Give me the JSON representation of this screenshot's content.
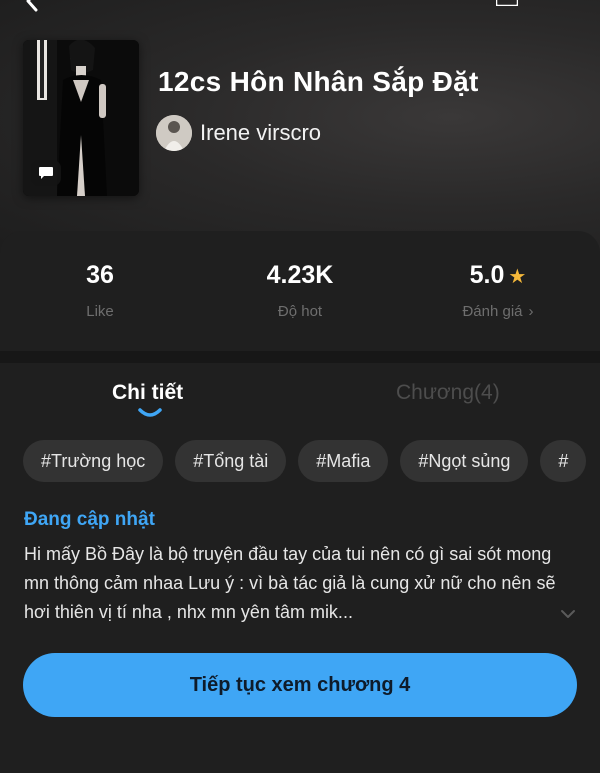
{
  "header": {
    "title": "12cs Hôn Nhân Sắp Đặt",
    "author": "Irene virscro"
  },
  "icons": {
    "back": "back-arrow-icon",
    "menu": "menu-icon",
    "comment": "comment-icon",
    "star": "star-icon",
    "chevron": "chevron-right-icon",
    "expand": "chevron-down-icon"
  },
  "stats": {
    "likes": {
      "value": "36",
      "label": "Like"
    },
    "hot": {
      "value": "4.23K",
      "label": "Độ hot"
    },
    "rating": {
      "value": "5.0",
      "label": "Đánh giá",
      "chevron": "›"
    }
  },
  "tabs": [
    {
      "label": "Chi tiết",
      "active": true
    },
    {
      "label": "Chương(4)",
      "active": false
    }
  ],
  "tags": [
    "#Trường học",
    "#Tổng tài",
    "#Mafia",
    "#Ngọt sủng",
    "#"
  ],
  "detail": {
    "status": "Đang cập nhật",
    "description": "Hi mấy Bồ  Đây là bộ truyện đầu tay của tui nên có gì sai sót mong mn thông cảm nhaa Lưu ý : vì bà tác giả là cung xử nữ cho nên sẽ hơi thiên vị tí nha , nhx mn yên tâm mik..."
  },
  "continue_button": "Tiếp tục xem chương 4",
  "colors": {
    "accent": "#3fa6f5",
    "star": "#f5b83a",
    "background": "#1f1f1f",
    "tag_bg": "#333333"
  }
}
